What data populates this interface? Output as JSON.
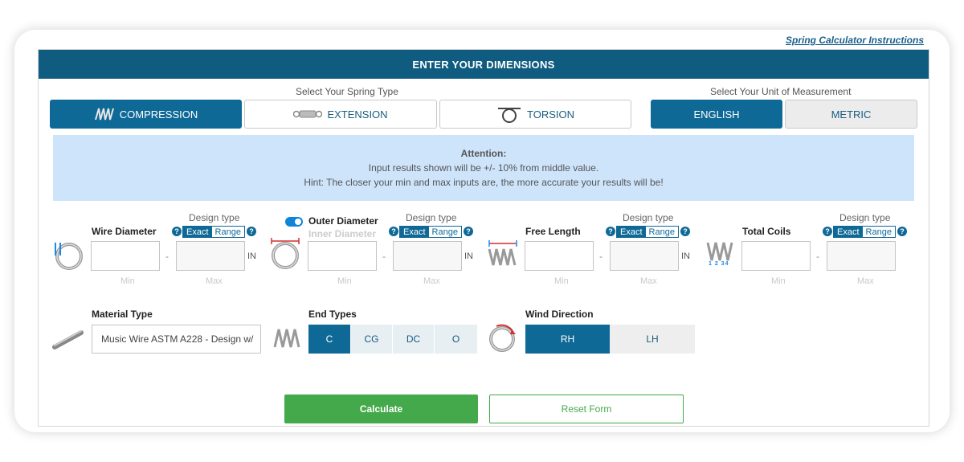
{
  "instructions_link": "Spring Calculator Instructions",
  "header_title": "ENTER YOUR DIMENSIONS",
  "spring_type": {
    "label": "Select Your Spring Type",
    "options": [
      "COMPRESSION",
      "EXTENSION",
      "TORSION"
    ],
    "selected": "COMPRESSION"
  },
  "unit": {
    "label": "Select Your Unit of Measurement",
    "options": [
      "ENGLISH",
      "METRIC"
    ],
    "selected": "ENGLISH"
  },
  "attention": {
    "title": "Attention:",
    "line1": "Input results shown will be +/- 10% from middle value.",
    "line2": "Hint: The closer your min and max inputs are, the more accurate your results will be!"
  },
  "design_type_label": "Design type",
  "design_exact": "Exact",
  "design_range": "Range",
  "help_glyph": "?",
  "dash": "-",
  "min_label": "Min",
  "max_label": "Max",
  "unit_suffix": "IN",
  "fields": {
    "wire_diameter": "Wire Diameter",
    "outer_diameter": "Outer Diameter",
    "inner_diameter": "Inner Diameter",
    "free_length": "Free Length",
    "total_coils": "Total Coils"
  },
  "material": {
    "label": "Material Type",
    "value": "Music Wire ASTM A228 - Design w/"
  },
  "end_types": {
    "label": "End Types",
    "options": [
      "C",
      "CG",
      "DC",
      "O"
    ],
    "selected": "C"
  },
  "wind_direction": {
    "label": "Wind Direction",
    "options": [
      "RH",
      "LH"
    ],
    "selected": "RH"
  },
  "coil_numbers": "1 2 34",
  "buttons": {
    "calculate": "Calculate",
    "reset": "Reset Form"
  },
  "colors": {
    "header": "#105b80",
    "primary": "#0f6996",
    "attention_bg": "#cde4fb",
    "calculate": "#44a94a"
  }
}
